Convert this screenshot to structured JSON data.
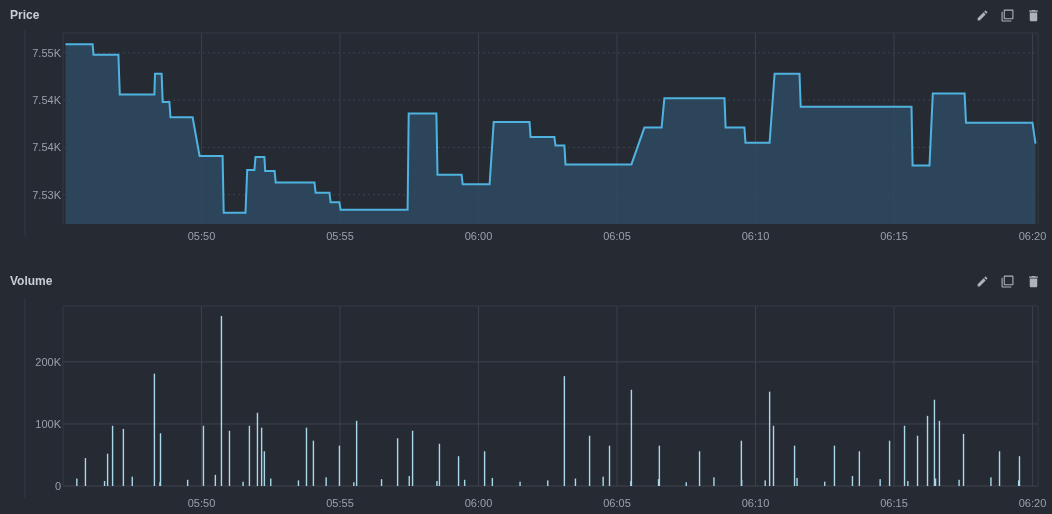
{
  "panels": [
    {
      "title": "Price",
      "chart_data": {
        "type": "area",
        "grid": true,
        "xlim": [
          345,
          380.2
        ],
        "ylim": [
          7526.9,
          7547.1
        ],
        "xticks": [
          {
            "value": 350,
            "label": "05:50"
          },
          {
            "value": 355,
            "label": "05:55"
          },
          {
            "value": 360,
            "label": "06:00"
          },
          {
            "value": 365,
            "label": "06:05"
          },
          {
            "value": 370,
            "label": "06:10"
          },
          {
            "value": 375,
            "label": "06:15"
          },
          {
            "value": 380,
            "label": "06:20"
          }
        ],
        "yticks": [
          {
            "value": 7545,
            "label": "7.55K"
          },
          {
            "value": 7540,
            "label": "7.54K"
          },
          {
            "value": 7535,
            "label": "7.54K"
          },
          {
            "value": 7530,
            "label": "7.53K"
          }
        ],
        "x": [
          345.09,
          346.07,
          346.1,
          347.0,
          347.05,
          348.3,
          348.32,
          348.56,
          348.6,
          348.84,
          348.88,
          349.68,
          349.93,
          350.76,
          350.8,
          351.59,
          351.65,
          351.91,
          351.95,
          352.27,
          352.3,
          352.64,
          352.68,
          354.08,
          354.12,
          354.62,
          354.66,
          354.98,
          355.02,
          357.44,
          357.48,
          358.48,
          358.52,
          359.39,
          359.43,
          360.4,
          360.55,
          361.84,
          361.88,
          362.74,
          362.78,
          363.1,
          363.14,
          365.52,
          365.99,
          366.61,
          366.71,
          368.88,
          368.92,
          369.6,
          369.64,
          370.51,
          370.69,
          371.59,
          371.63,
          375.63,
          375.67,
          376.28,
          376.4,
          377.55,
          377.6,
          380.0,
          380.11
        ],
        "series": [
          {
            "color": "#4fb3e0",
            "values": [
              7545.9,
              7545.9,
              7544.8,
              7544.8,
              7540.6,
              7540.6,
              7542.8,
              7542.8,
              7539.8,
              7539.8,
              7538.2,
              7538.2,
              7534.1,
              7534.1,
              7528.1,
              7528.1,
              7532.6,
              7532.6,
              7534.0,
              7534.0,
              7532.5,
              7532.5,
              7531.3,
              7531.3,
              7530.2,
              7530.2,
              7529.2,
              7529.2,
              7528.4,
              7528.4,
              7538.6,
              7538.6,
              7532.1,
              7532.1,
              7531.1,
              7531.1,
              7537.7,
              7537.7,
              7536.1,
              7536.1,
              7535.2,
              7535.2,
              7533.2,
              7533.2,
              7537.1,
              7537.1,
              7540.2,
              7540.2,
              7537.1,
              7537.1,
              7535.5,
              7535.5,
              7542.8,
              7542.8,
              7539.3,
              7539.3,
              7533.1,
              7533.1,
              7540.7,
              7540.7,
              7537.6,
              7537.6,
              7535.4
            ]
          }
        ]
      }
    },
    {
      "title": "Volume",
      "chart_data": {
        "type": "bar",
        "grid": true,
        "xlim": [
          345,
          380.2
        ],
        "ylim": [
          0,
          290000
        ],
        "xticks": [
          {
            "value": 350,
            "label": "05:50"
          },
          {
            "value": 355,
            "label": "05:55"
          },
          {
            "value": 360,
            "label": "06:00"
          },
          {
            "value": 365,
            "label": "06:05"
          },
          {
            "value": 370,
            "label": "06:10"
          },
          {
            "value": 375,
            "label": "06:15"
          },
          {
            "value": 380,
            "label": "06:20"
          }
        ],
        "yticks": [
          {
            "value": 0,
            "label": "0"
          },
          {
            "value": 100000,
            "label": "100K"
          },
          {
            "value": 200000,
            "label": "200K"
          }
        ],
        "x": [
          345.5,
          345.81,
          346.5,
          346.61,
          346.79,
          347.18,
          347.5,
          348.3,
          348.5,
          348.52,
          349.5,
          350.07,
          350.5,
          350.72,
          351.01,
          351.5,
          351.73,
          352.02,
          352.17,
          352.27,
          352.5,
          353.5,
          353.79,
          354.04,
          354.5,
          354.98,
          355.5,
          355.6,
          356.5,
          357.08,
          357.5,
          357.62,
          358.5,
          358.59,
          359.28,
          359.5,
          360.22,
          360.5,
          361.5,
          362.5,
          363.1,
          363.5,
          364.01,
          364.5,
          364.73,
          365.5,
          365.52,
          366.5,
          366.53,
          367.5,
          367.98,
          368.5,
          369.49,
          369.5,
          370.35,
          370.51,
          370.65,
          371.41,
          371.5,
          372.5,
          372.85,
          373.5,
          373.75,
          374.5,
          374.84,
          375.38,
          375.5,
          375.85,
          376.21,
          376.46,
          376.5,
          376.64,
          377.35,
          377.51,
          378.5,
          378.81,
          379.5,
          379.53
        ],
        "series": [
          {
            "color": "#a8d8ea",
            "values": [
              12000,
              45000,
              8000,
              52000,
              97000,
              92000,
              15000,
              181000,
              6000,
              85000,
              10000,
              97000,
              18000,
              274000,
              89000,
              7000,
              97000,
              118000,
              94000,
              56000,
              12000,
              9000,
              94000,
              73000,
              14000,
              65000,
              6000,
              105000,
              11000,
              77000,
              16000,
              89000,
              8000,
              68000,
              48000,
              10000,
              56000,
              13000,
              7000,
              9000,
              177000,
              12000,
              81000,
              15000,
              65000,
              8000,
              155000,
              11000,
              65000,
              6000,
              56000,
              14000,
              73000,
              10000,
              9000,
              152000,
              97000,
              65000,
              13000,
              7000,
              65000,
              16000,
              56000,
              11000,
              73000,
              97000,
              8000,
              81000,
              113000,
              139000,
              12000,
              105000,
              10000,
              84000,
              14000,
              56000,
              9000,
              48000
            ]
          }
        ]
      }
    }
  ]
}
